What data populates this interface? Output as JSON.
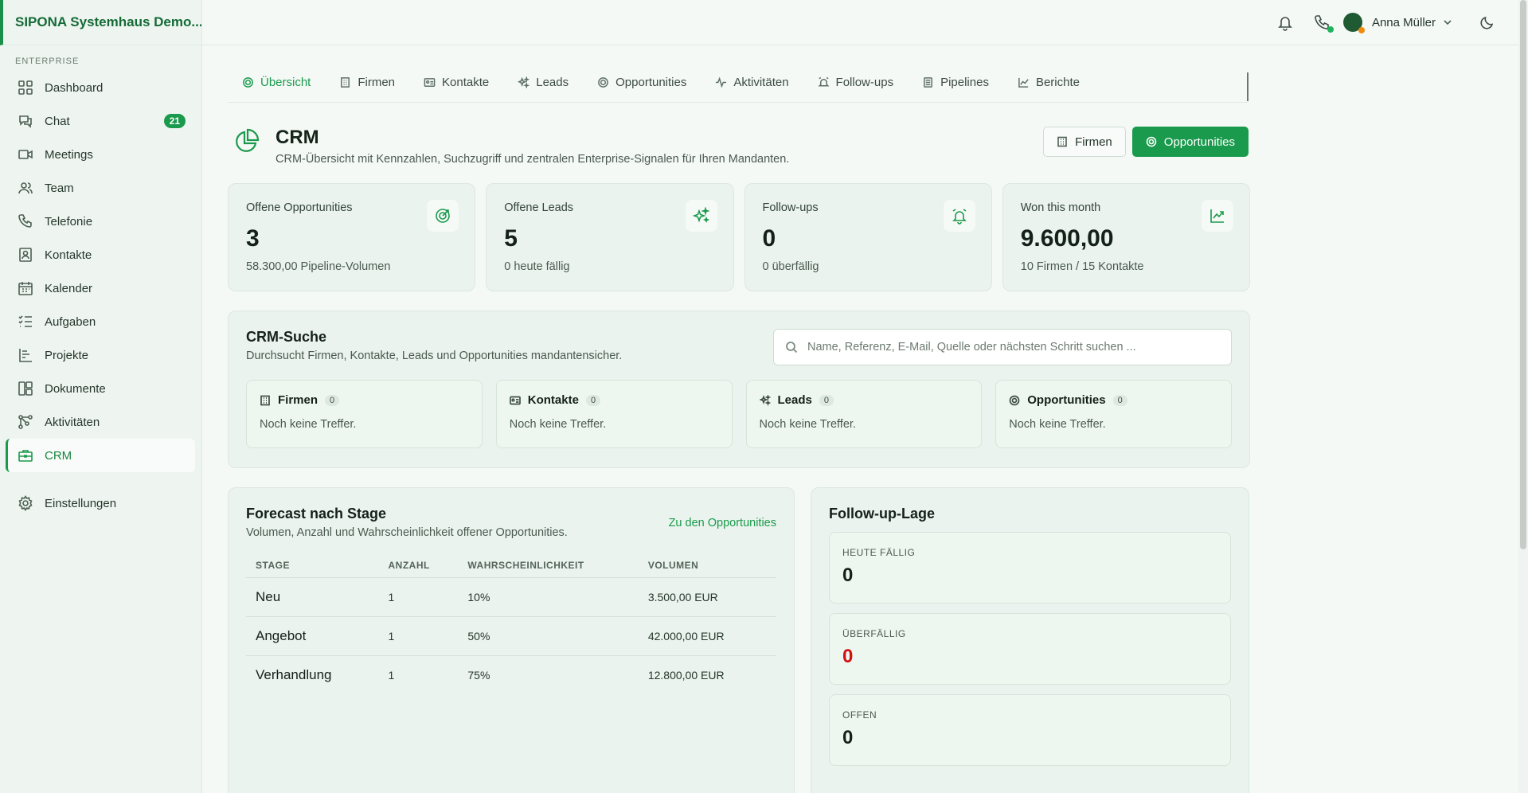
{
  "brand": "SIPONA Systemhaus Demo...",
  "sidebar": {
    "section": "ENTERPRISE",
    "items": [
      {
        "label": "Dashboard",
        "icon": "grid-icon"
      },
      {
        "label": "Chat",
        "icon": "chat-icon",
        "badge": "21"
      },
      {
        "label": "Meetings",
        "icon": "video-icon"
      },
      {
        "label": "Team",
        "icon": "users-icon"
      },
      {
        "label": "Telefonie",
        "icon": "phone-icon"
      },
      {
        "label": "Kontakte",
        "icon": "contact-icon"
      },
      {
        "label": "Kalender",
        "icon": "calendar-icon"
      },
      {
        "label": "Aufgaben",
        "icon": "tasks-icon"
      },
      {
        "label": "Projekte",
        "icon": "projects-icon"
      },
      {
        "label": "Dokumente",
        "icon": "documents-icon"
      },
      {
        "label": "Aktivitäten",
        "icon": "activity-icon"
      },
      {
        "label": "CRM",
        "icon": "briefcase-icon",
        "active": true
      }
    ],
    "settings": "Einstellungen"
  },
  "topbar": {
    "user_name": "Anna Müller",
    "phone_status_color": "#1fb45a",
    "avatar_status_color": "#f08a0c"
  },
  "tabs": [
    {
      "label": "Übersicht",
      "active": true
    },
    {
      "label": "Firmen"
    },
    {
      "label": "Kontakte"
    },
    {
      "label": "Leads"
    },
    {
      "label": "Opportunities"
    },
    {
      "label": "Aktivitäten"
    },
    {
      "label": "Follow-ups"
    },
    {
      "label": "Pipelines"
    },
    {
      "label": "Berichte"
    }
  ],
  "header": {
    "title": "CRM",
    "subtitle": "CRM-Übersicht mit Kennzahlen, Suchzugriff und zentralen Enterprise-Signalen für Ihren Mandanten.",
    "btn_firmen": "Firmen",
    "btn_opportunities": "Opportunities"
  },
  "kpis": [
    {
      "label": "Offene Opportunities",
      "value": "3",
      "sub": "58.300,00 Pipeline-Volumen",
      "icon": "target-icon"
    },
    {
      "label": "Offene Leads",
      "value": "5",
      "sub": "0 heute fällig",
      "icon": "sparkles-icon"
    },
    {
      "label": "Follow-ups",
      "value": "0",
      "sub": "0 überfällig",
      "icon": "alarm-icon"
    },
    {
      "label": "Won this month",
      "value": "9.600,00",
      "sub": "10 Firmen / 15 Kontakte",
      "icon": "trend-up-icon"
    }
  ],
  "search": {
    "title": "CRM-Suche",
    "subtitle": "Durchsucht Firmen, Kontakte, Leads und Opportunities mandantensicher.",
    "placeholder": "Name, Referenz, E-Mail, Quelle oder nächsten Schritt suchen ...",
    "results": [
      {
        "label": "Firmen",
        "count": "0",
        "empty": "Noch keine Treffer."
      },
      {
        "label": "Kontakte",
        "count": "0",
        "empty": "Noch keine Treffer."
      },
      {
        "label": "Leads",
        "count": "0",
        "empty": "Noch keine Treffer."
      },
      {
        "label": "Opportunities",
        "count": "0",
        "empty": "Noch keine Treffer."
      }
    ]
  },
  "forecast": {
    "title": "Forecast nach Stage",
    "subtitle": "Volumen, Anzahl und Wahrscheinlichkeit offener Opportunities.",
    "link": "Zu den Opportunities",
    "columns": [
      "STAGE",
      "ANZAHL",
      "WAHRSCHEINLICHKEIT",
      "VOLUMEN"
    ],
    "rows": [
      [
        "Neu",
        "1",
        "10%",
        "3.500,00 EUR"
      ],
      [
        "Angebot",
        "1",
        "50%",
        "42.000,00 EUR"
      ],
      [
        "Verhandlung",
        "1",
        "75%",
        "12.800,00 EUR"
      ]
    ]
  },
  "followup": {
    "title": "Follow-up-Lage",
    "boxes": [
      {
        "label": "HEUTE FÄLLIG",
        "value": "0"
      },
      {
        "label": "ÜBERFÄLLIG",
        "value": "0",
        "color": "#d01010"
      },
      {
        "label": "OFFEN",
        "value": "0"
      }
    ]
  }
}
